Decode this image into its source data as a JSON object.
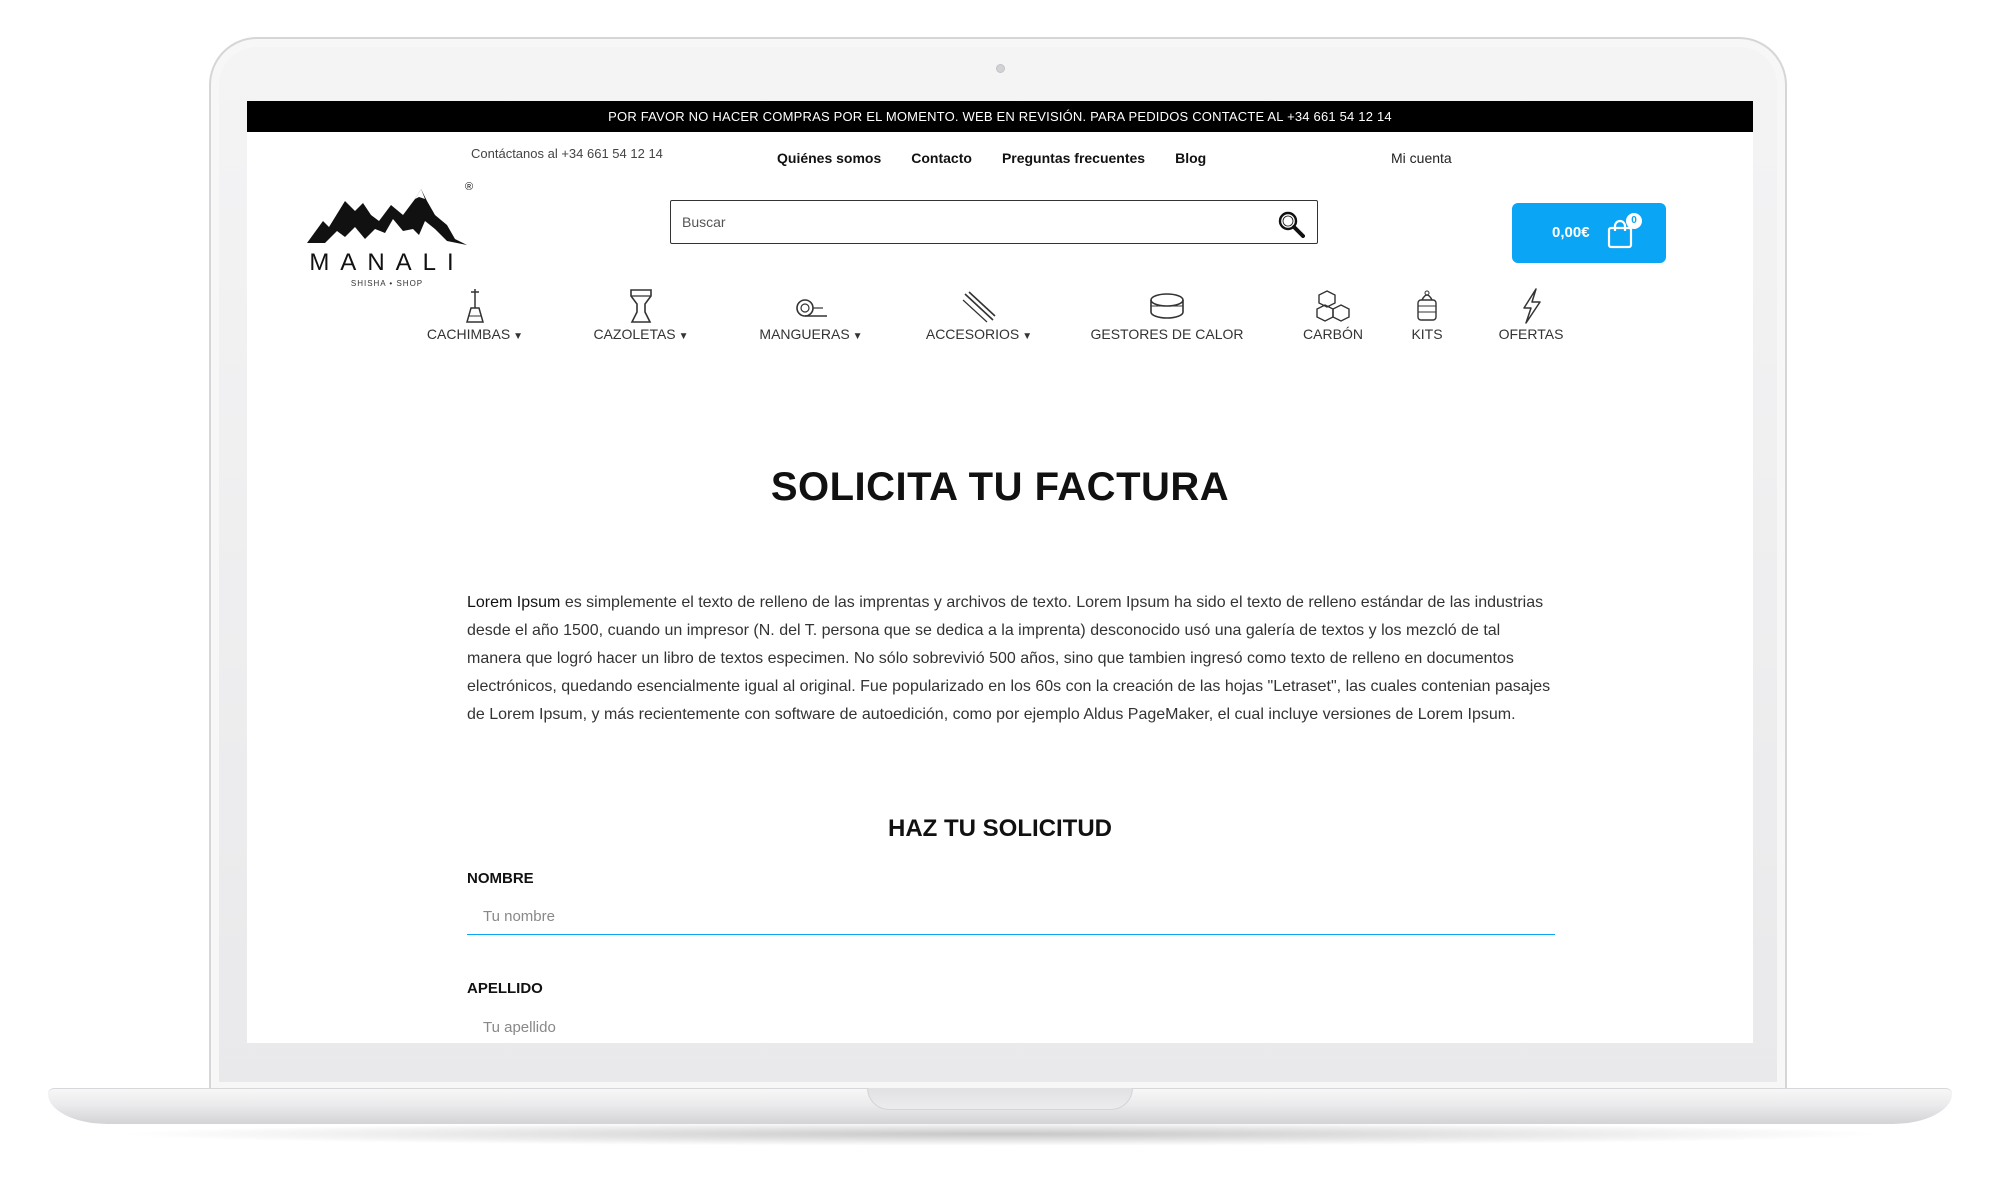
{
  "announcement": "POR FAVOR NO HACER COMPRAS POR EL MOMENTO. WEB EN REVISIÓN. PARA PEDIDOS CONTACTE AL +34 661 54 12 14",
  "header": {
    "contact": "Contáctanos al +34 661 54 12 14",
    "links": [
      "Quiénes somos",
      "Contacto",
      "Preguntas frecuentes",
      "Blog"
    ],
    "account": "Mi cuenta"
  },
  "logo": {
    "word": "MANALI",
    "sub": "SHISHA • SHOP",
    "reg": "®"
  },
  "search": {
    "placeholder": "Buscar",
    "icon": "search-icon"
  },
  "cart": {
    "total": "0,00€",
    "count": "0",
    "icon": "shopping-bag-icon",
    "color": "#0aa5f5"
  },
  "categories": [
    {
      "label": "CACHIMBAS",
      "icon": "hookah-icon",
      "dropdown": true
    },
    {
      "label": "CAZOLETAS",
      "icon": "bowl-icon",
      "dropdown": true
    },
    {
      "label": "MANGUERAS",
      "icon": "hose-icon",
      "dropdown": true
    },
    {
      "label": "ACCESORIOS",
      "icon": "tongs-icon",
      "dropdown": true
    },
    {
      "label": "GESTORES DE CALOR",
      "icon": "heat-manager-icon",
      "dropdown": false
    },
    {
      "label": "CARBÓN",
      "icon": "charcoal-cubes-icon",
      "dropdown": false
    },
    {
      "label": "KITS",
      "icon": "kit-icon",
      "dropdown": false
    },
    {
      "label": "OFERTAS",
      "icon": "lightning-icon",
      "dropdown": false
    }
  ],
  "main": {
    "title": "SOLICITA TU FACTURA",
    "intro_lead": "Lorem Ipsum",
    "intro_body": " es simplemente el texto de relleno de las imprentas y archivos de texto. Lorem Ipsum ha sido el texto de relleno estándar de las industrias desde el año 1500, cuando un impresor (N. del T. persona que se dedica a la imprenta) desconocido usó una galería de textos y los mezcló de tal manera que logró hacer un libro de textos especimen. No sólo sobrevivió 500 años, sino que tambien ingresó como texto de relleno en documentos electrónicos, quedando esencialmente igual al original. Fue popularizado en los 60s con la creación de las hojas \"Letraset\", las cuales contenian pasajes de Lorem Ipsum, y más recientemente con software de autoedición, como por ejemplo Aldus PageMaker, el cual incluye versiones de Lorem Ipsum.",
    "form_title": "HAZ TU SOLICITUD",
    "fields": [
      {
        "label": "NOMBRE",
        "placeholder": "Tu nombre"
      },
      {
        "label": "APELLIDO",
        "placeholder": "Tu apellido"
      }
    ]
  }
}
